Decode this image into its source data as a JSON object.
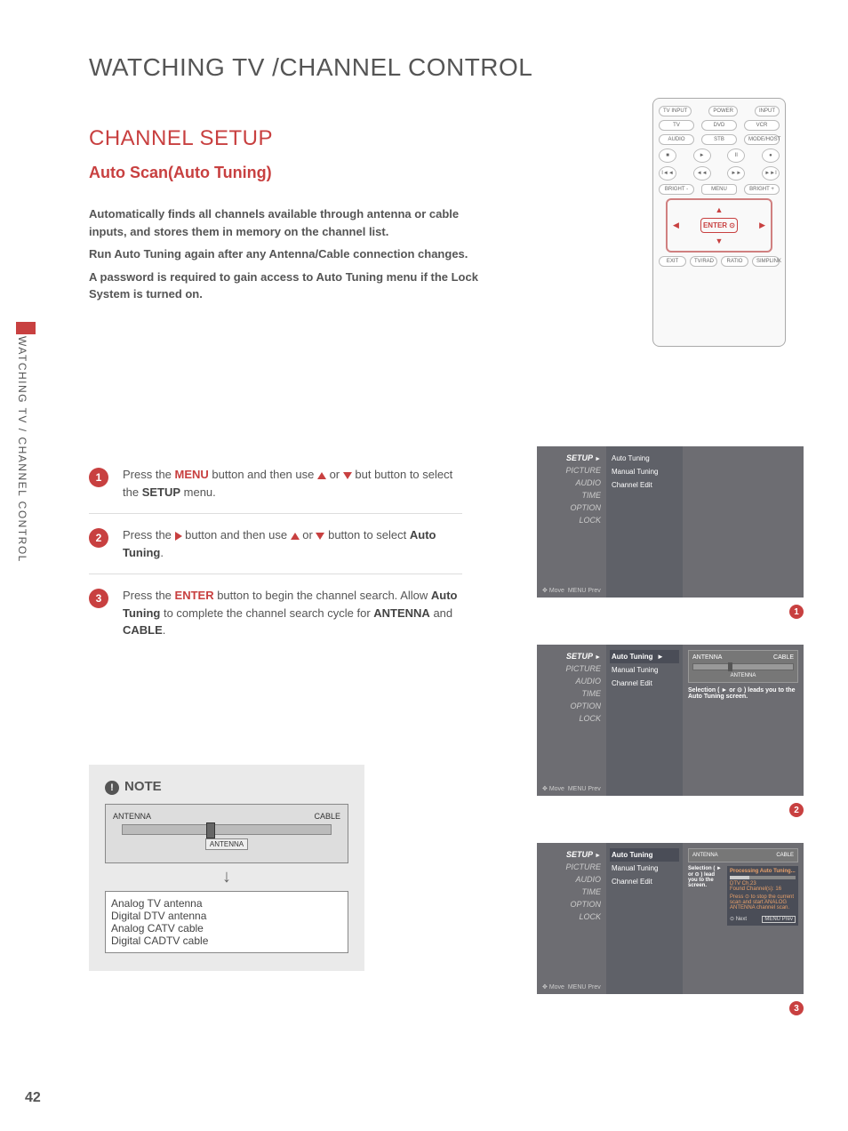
{
  "page_number": "42",
  "title": "WATCHING TV /CHANNEL CONTROL",
  "side_tab": "WATCHING TV / CHANNEL CONTROL",
  "section_title": "CHANNEL SETUP",
  "sub_title": "Auto Scan(Auto Tuning)",
  "intro": {
    "p1": "Automatically finds all channels available through antenna or cable inputs, and stores them in memory on the channel list.",
    "p2": "Run Auto Tuning again after any Antenna/Cable connection changes.",
    "p3": "A password is required to gain access to Auto Tuning menu if the Lock System is turned on."
  },
  "remote": {
    "tv_input": "TV INPUT",
    "power": "POWER",
    "input": "INPUT",
    "tv": "TV",
    "dvd": "DVD",
    "vcr": "VCR",
    "audio": "AUDIO",
    "stb": "STB",
    "modehost": "MODE/HOST",
    "stop": "■",
    "play": "►",
    "pause": "II",
    "rec": "●",
    "prev": "I◄◄",
    "rew": "◄◄",
    "ff": "►►",
    "next": "►►I",
    "bright_minus": "BRIGHT -",
    "menu": "MENU",
    "bright_plus": "BRIGHT +",
    "enter": "ENTER\n⊙",
    "up": "▲",
    "down": "▼",
    "left": "◀",
    "right": "▶",
    "exit": "EXIT",
    "tvradio": "TV/RAD",
    "ratio": "RATIO",
    "simplink": "SIMPLINK"
  },
  "steps": [
    {
      "num": "1",
      "pre": "Press the ",
      "hl": "MENU",
      "mid": " button and then use ",
      "post": " button to select the ",
      "strong": "SETUP",
      "tail": " menu."
    },
    {
      "num": "2",
      "pre": "Press the ",
      "mid": " button and then use ",
      "post": " button to select ",
      "strong": "Auto Tuning",
      "tail": "."
    },
    {
      "num": "3",
      "pre": "Press the ",
      "hl": "ENTER",
      "mid": " button to begin the channel search. Allow ",
      "strong": "Auto Tuning",
      "post": " to complete the channel search cycle for ",
      "strong2": "ANTENNA",
      "and": " and ",
      "strong3": "CABLE",
      "tail": "."
    }
  ],
  "note": {
    "title": "NOTE",
    "antenna": "ANTENNA",
    "cable": "CABLE",
    "antenna_label": "ANTENNA",
    "signals": [
      "Analog TV antenna",
      "Digital DTV antenna",
      "Analog CATV cable",
      "Digital CADTV cable"
    ]
  },
  "osd": {
    "menu": [
      "SETUP",
      "PICTURE",
      "AUDIO",
      "TIME",
      "OPTION",
      "LOCK"
    ],
    "submenu": [
      "Auto Tuning",
      "Manual Tuning",
      "Channel Edit"
    ],
    "footer_move": "Move",
    "footer_prev": "MENU Prev",
    "preview": {
      "antenna": "ANTENNA",
      "cable": "CABLE",
      "hint": "Selection ( ► or ⊙ ) leads you to the Auto Tuning screen."
    },
    "processing": {
      "title": "Processing Auto Tuning...",
      "ch": "DTV Ch.23",
      "found": "Found Channel(s): 16",
      "stop": "Press ⊙ to stop the current scan and start ANALOG ANTENNA channel scan.",
      "next": "⊙ Next",
      "prev": "MENU Prev",
      "hint_left": "Selection ( ► or ⊙ ) lead you to the screen."
    }
  }
}
